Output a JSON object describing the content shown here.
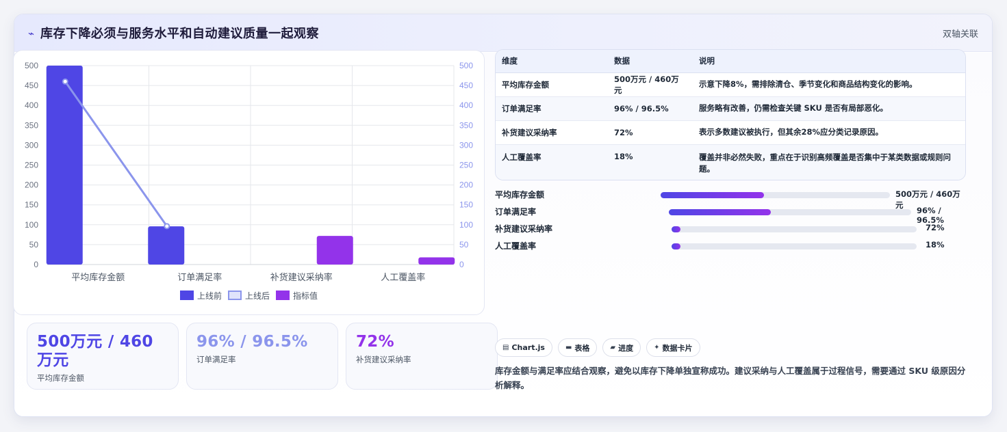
{
  "header": {
    "icon": "trend-icon",
    "title": "库存下降必须与服务水平和自动建议质量一起观察",
    "tag": "双轴关联"
  },
  "colors": {
    "before": "#4f46e5",
    "after": "#8b95ec",
    "indicator": "#9333ea",
    "accent": "#4338ca"
  },
  "chart_data": {
    "type": "bar",
    "categories": [
      "平均库存金额",
      "订单满足率",
      "补货建议采纳率",
      "人工覆盖率"
    ],
    "series": [
      {
        "name": "上线前",
        "type": "bar",
        "values": [
          500,
          96,
          null,
          null
        ]
      },
      {
        "name": "上线后",
        "type": "line",
        "values": [
          460,
          96.5,
          null,
          null
        ]
      },
      {
        "name": "指标值",
        "type": "bar",
        "values": [
          null,
          null,
          72,
          18
        ]
      }
    ],
    "ylim": [
      0,
      500
    ],
    "y2lim": [
      0,
      500
    ],
    "yticks": [
      "0",
      "50",
      "100",
      "150",
      "200",
      "250",
      "300",
      "350",
      "400",
      "450",
      "500"
    ],
    "legend_position": "bottom",
    "grid": true
  },
  "kpis": [
    {
      "value": "500万元 / 460万元",
      "label": "平均库存金额",
      "color": "#4f46e5"
    },
    {
      "value": "96% / 96.5%",
      "label": "订单满足率",
      "color": "#8b95ec"
    },
    {
      "value": "72%",
      "label": "补货建议采纳率",
      "color": "#9333ea"
    }
  ],
  "table": {
    "headers": [
      "维度",
      "数据",
      "说明"
    ],
    "rows": [
      [
        "平均库存金额",
        "500万元 / 460万元",
        "示意下降8%，需排除清仓、季节变化和商品结构变化的影响。"
      ],
      [
        "订单满足率",
        "96% / 96.5%",
        "服务略有改善，仍需检查关键 SKU 是否有局部恶化。"
      ],
      [
        "补货建议采纳率",
        "72%",
        "表示多数建议被执行，但其余28%应分类记录原因。"
      ],
      [
        "人工覆盖率",
        "18%",
        "覆盖并非必然失败，重点在于识别高频覆盖是否集中于某类数据或规则问题。"
      ]
    ]
  },
  "progress": [
    {
      "label": "平均库存金额",
      "value": "500万元 / 460万元",
      "fraction": 0.45
    },
    {
      "label": "订单满足率",
      "value": "96% / 96.5%",
      "fraction": 0.42
    },
    {
      "label": "补货建议采纳率",
      "value": "72%",
      "fraction": 0.035
    },
    {
      "label": "人工覆盖率",
      "value": "18%",
      "fraction": 0.035
    }
  ],
  "chips": [
    {
      "icon": "chart-icon",
      "label": "Chart.js"
    },
    {
      "icon": "table-icon",
      "label": "表格"
    },
    {
      "icon": "progress-icon",
      "label": "进度"
    },
    {
      "icon": "card-icon",
      "label": "数据卡片"
    }
  ],
  "note": "库存金额与满足率应结合观察，避免以库存下降单独宣称成功。建议采纳与人工覆盖属于过程信号，需要通过 SKU 级原因分析解释。"
}
